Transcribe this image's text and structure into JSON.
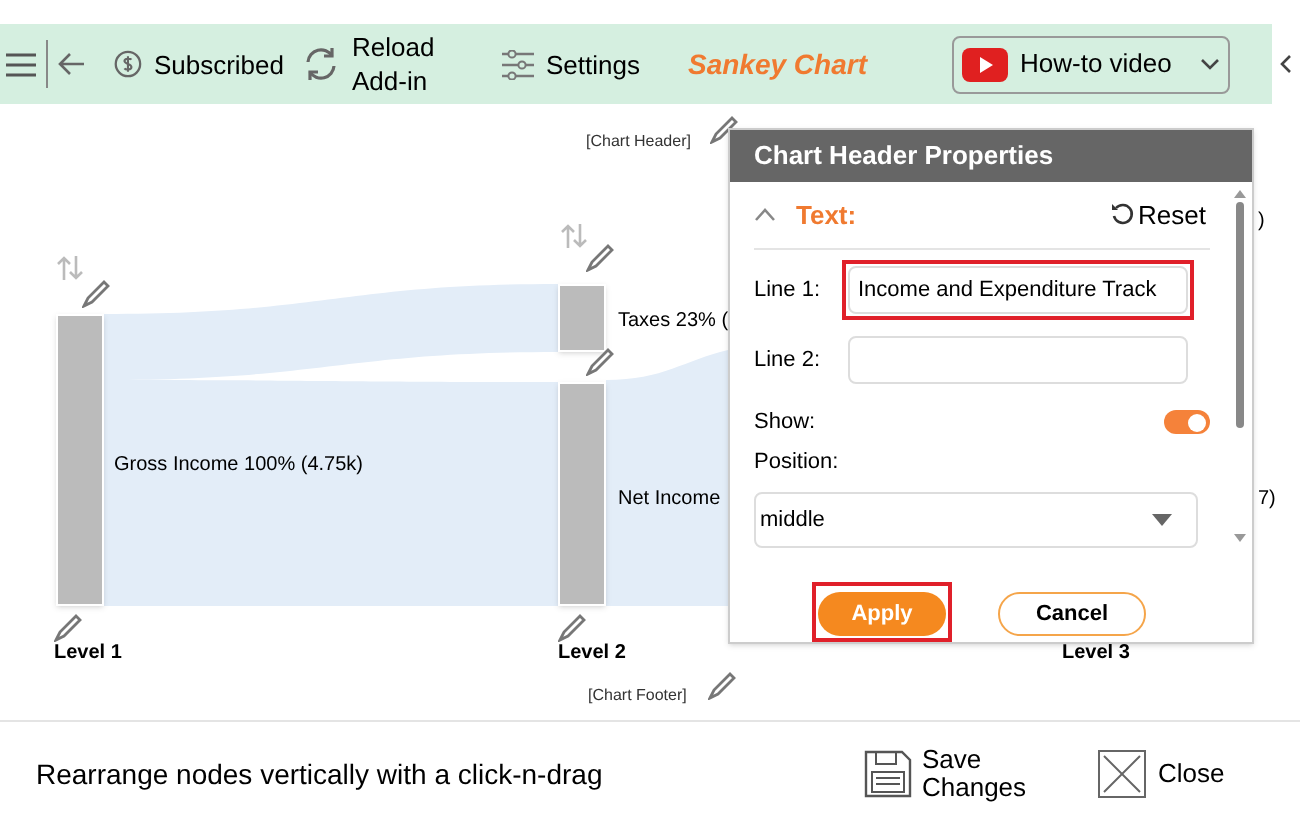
{
  "toolbar": {
    "items": [
      {
        "kind": "subscribed",
        "label": "Subscribed"
      },
      {
        "kind": "reload",
        "label": "Reload Add-in"
      },
      {
        "kind": "settings",
        "label": "Settings"
      }
    ],
    "title": "Sankey Chart",
    "video_button": "How-to video"
  },
  "chart": {
    "header": "[Chart Header]",
    "footer": "[Chart Footer]",
    "nodes": [
      {
        "label": "Gross Income 100% (4.75k)"
      },
      {
        "label": "Taxes 23% ("
      },
      {
        "label": "Net Income"
      }
    ],
    "fragments": [
      ")",
      "7)"
    ],
    "levels": [
      "Level 1",
      "Level 2",
      "Level 3"
    ]
  },
  "dialog": {
    "title": "Chart Header Properties",
    "section": "Text:",
    "expanded": true,
    "reset": "Reset",
    "fields": [
      {
        "label": "Line 1:",
        "value": "Income and Expenditure Track",
        "highlighted": true
      },
      {
        "label": "Line 2:",
        "highlighted": false
      }
    ],
    "show": {
      "label": "Show:",
      "on": true
    },
    "position": {
      "label": "Position:",
      "value": "middle"
    },
    "buttons": [
      {
        "label": "Apply",
        "kind": "primary",
        "highlighted": true
      },
      {
        "label": "Cancel",
        "kind": "secondary",
        "highlighted": false
      }
    ]
  },
  "footer": {
    "hint": "Rearrange nodes vertically with a click-n-drag",
    "save": "Save Changes",
    "close": "Close"
  }
}
